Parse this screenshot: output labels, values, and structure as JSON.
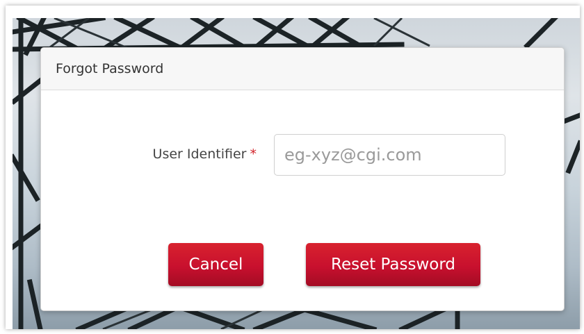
{
  "modal": {
    "title": "Forgot Password"
  },
  "form": {
    "user_identifier": {
      "label": "User Identifier",
      "required_marker": "*",
      "placeholder": "eg-xyz@cgi.com",
      "value": ""
    }
  },
  "actions": {
    "cancel_label": "Cancel",
    "reset_label": "Reset Password"
  },
  "colors": {
    "accent": "#c8102e",
    "required": "#d2232a"
  }
}
